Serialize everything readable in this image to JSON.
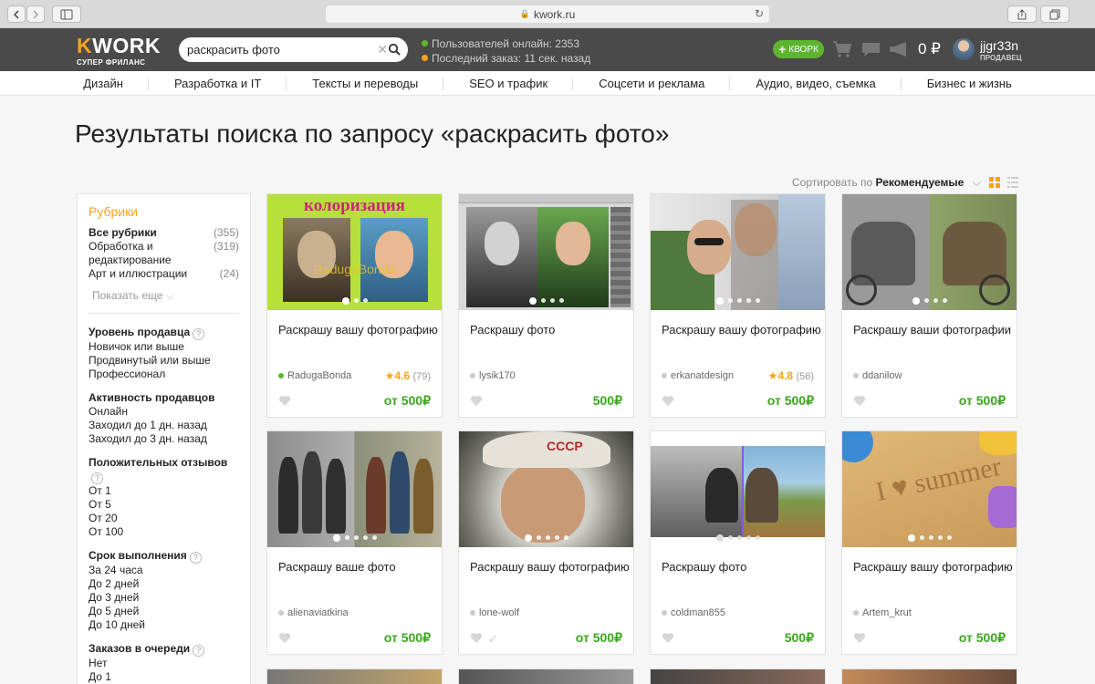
{
  "browser": {
    "url": "kwork.ru"
  },
  "header": {
    "logo_k": "K",
    "logo_rest": "WORK",
    "logo_sub": "СУПЕР ФРИЛАНС",
    "search_value": "раскрасить фото",
    "stat_online": "Пользователей онлайн: 2353",
    "stat_last": "Последний заказ: 11 сек. назад",
    "kwork_btn": "КВОРК",
    "balance": "0 ₽",
    "username": "jjgr33n",
    "role": "ПРОДАВЕЦ",
    "colors": {
      "online": "#5db42d",
      "last": "#f7a21b",
      "accent": "#f7a21b",
      "green": "#5db42d"
    }
  },
  "nav": [
    {
      "label": "Дизайн"
    },
    {
      "label": "Разработка и IT"
    },
    {
      "label": "Тексты и переводы"
    },
    {
      "label": "SEO и трафик"
    },
    {
      "label": "Соцсети и реклама"
    },
    {
      "label": "Аудио, видео, съемка"
    },
    {
      "label": "Бизнес и жизнь"
    }
  ],
  "page_title": "Результаты поиска по запросу «раскрасить фото»",
  "sort": {
    "prefix": "Сортировать по",
    "value": "Рекомендуемые"
  },
  "sidebar": {
    "title": "Рубрики",
    "rubrics": [
      {
        "name": "Все рубрики",
        "count": "(355)"
      },
      {
        "name": "Обработка и редактирование",
        "count": "(319)"
      },
      {
        "name": "Арт и иллюстрации",
        "count": "(24)"
      }
    ],
    "show_more": "Показать еще",
    "groups": [
      {
        "title": "Уровень продавца",
        "options": [
          "Новичок или выше",
          "Продвинутый или выше",
          "Профессионал"
        ]
      },
      {
        "title": "Активность продавцов",
        "options": [
          "Онлайн",
          "Заходил до 1 дн. назад",
          "Заходил до 3 дн. назад"
        ]
      },
      {
        "title": "Положительных отзывов",
        "options": [
          "От 1",
          "От 5",
          "От 20",
          "От 100"
        ]
      },
      {
        "title": "Срок выполнения",
        "options": [
          "За 24 часа",
          "До 2 дней",
          "До 3 дней",
          "До 5 дней",
          "До 10 дней"
        ]
      },
      {
        "title": "Заказов в очереди",
        "options": [
          "Нет",
          "До 1"
        ]
      }
    ]
  },
  "cards": [
    {
      "title": "Раскрашу вашу фотографию",
      "seller": "RadugaBonda",
      "online": true,
      "rating": "4.6",
      "reviews": "(79)",
      "price_prefix": "от",
      "price": "500₽",
      "image_text": "колоризация",
      "watermark": "RadugaBonda"
    },
    {
      "title": "Раскрашу фото",
      "seller": "lysik170",
      "online": false,
      "price_prefix": "",
      "price": "500₽"
    },
    {
      "title": "Раскрашу вашу фотографию",
      "seller": "erkanatdesign",
      "online": false,
      "rating": "4.8",
      "reviews": "(56)",
      "price_prefix": "от",
      "price": "500₽"
    },
    {
      "title": "Раскрашу ваши фотографии",
      "seller": "ddanilow",
      "online": false,
      "price_prefix": "от",
      "price": "500₽"
    },
    {
      "title": "Раскрашу ваше фото",
      "seller": "alienaviatkina",
      "online": false,
      "price_prefix": "от",
      "price": "500₽"
    },
    {
      "title": "Раскрашу вашу фотографию",
      "seller": "lone-wolf",
      "online": false,
      "price_prefix": "от",
      "price": "500₽"
    },
    {
      "title": "Раскрашу фото",
      "seller": "coldman855",
      "online": false,
      "price_prefix": "",
      "price": "500₽"
    },
    {
      "title": "Раскрашу вашу фотографию",
      "seller": "Artem_krut",
      "online": false,
      "price_prefix": "от",
      "price": "500₽",
      "image_text": "I ♥ summer"
    }
  ]
}
